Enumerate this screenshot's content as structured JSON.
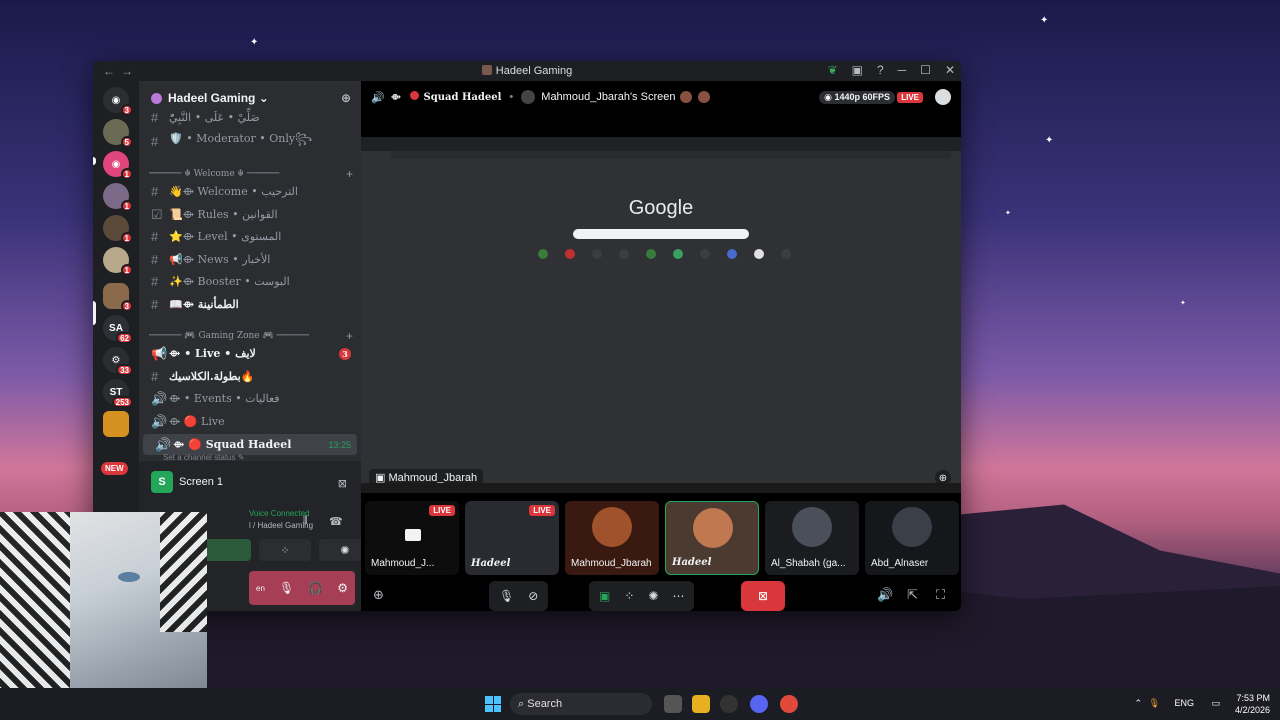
{
  "window": {
    "title": "Hadeel Gaming"
  },
  "server": {
    "name": "Hadeel Gaming"
  },
  "rail": [
    {
      "badge": "3"
    },
    {
      "badge": "5"
    },
    {
      "badge": "1"
    },
    {
      "badge": "1"
    },
    {
      "badge": "1"
    },
    {
      "badge": "1"
    },
    {
      "badge": "3"
    },
    {
      "badge": "62"
    },
    {
      "badge": "33"
    },
    {
      "badge": "253"
    },
    {
      "badge": ""
    }
  ],
  "rail_new": "NEW",
  "channels": [
    {
      "name": "صَلِّيْ • عَلَى • النَّبِيّْ",
      "type": "text"
    },
    {
      "name": "🛡️ • Moderator • Only꧂",
      "type": "text"
    },
    {
      "name": "👋⟴ Welcome • الترحيب",
      "type": "text"
    },
    {
      "name": "📜⟴ Rules • القوانين",
      "type": "rules"
    },
    {
      "name": "⭐⟴ Level • المستوى",
      "type": "text"
    },
    {
      "name": "📢⟴ News • الأخبار",
      "type": "text"
    },
    {
      "name": "✨⟴ Booster • البوست",
      "type": "text"
    },
    {
      "name": "📖⟴ الطمأنينة",
      "type": "text"
    },
    {
      "name": "⟴ • Live • لايف",
      "type": "announce",
      "badge": "3"
    },
    {
      "name": "بطولة.الكلاسيك🔥",
      "type": "text"
    },
    {
      "name": "⟴ • Events • فعاليات",
      "type": "voice"
    },
    {
      "name": "⟴ 🔴 Live",
      "type": "voice"
    },
    {
      "name": "⟴ 🔴 Squad Hadeel",
      "type": "voice",
      "time": "13:25"
    }
  ],
  "categories": {
    "welcome": "────── ☬ Welcome ☬ ──────",
    "gaming": "────── 🎮 Gaming Zone 🎮 ──────"
  },
  "status_placeholder": "Set a channel status ✎",
  "voice_panel": {
    "screen_label": "Screen 1",
    "status_fragment": "Voice Connected",
    "channel_fragment": "l / Hadeel Gaming",
    "user_fragment": "en"
  },
  "header": {
    "channel": "Squad Hadeel",
    "stream_title": "Mahmoud_Jbarah's Screen",
    "quality": "1440p 60FPS",
    "live": "LIVE"
  },
  "stream": {
    "google": "Google",
    "streamer": "Mahmoud_Jbarah"
  },
  "tiles": [
    {
      "label": "Mahmoud_J...",
      "live": "LIVE",
      "kind": "screen"
    },
    {
      "label": "Hadeel",
      "live": "LIVE",
      "kind": "stream"
    },
    {
      "label": "Mahmoud_Jbarah",
      "live": "",
      "kind": "face",
      "color": "#a0522d"
    },
    {
      "label": "Hadeel",
      "live": "",
      "kind": "face",
      "color": "#c07850",
      "speaking": true
    },
    {
      "label": "Al_Shabah (ga...",
      "live": "",
      "kind": "face",
      "color": "#4a4f5a"
    },
    {
      "label": "Abd_Alnaser",
      "live": "",
      "kind": "face",
      "color": "#3a3f48"
    }
  ],
  "taskbar": {
    "search": "Search",
    "lang": "ENG",
    "time": "7:53 PM",
    "date": "4/2/2026"
  },
  "colors": {
    "accent": "#5865f2",
    "danger": "#da373c",
    "online": "#23a55a"
  }
}
